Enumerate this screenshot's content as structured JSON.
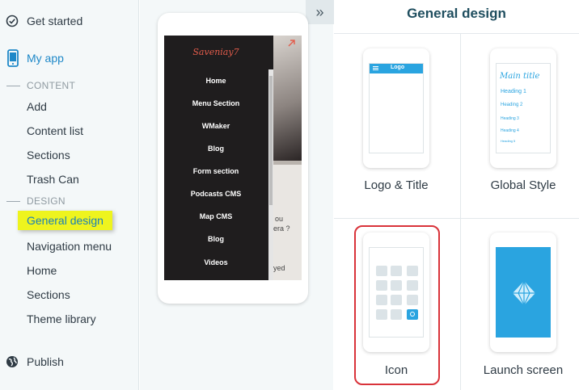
{
  "sidebar": {
    "get_started": "Get started",
    "my_app": "My app",
    "content_header": "CONTENT",
    "content_items": [
      "Add",
      "Content list",
      "Sections",
      "Trash Can"
    ],
    "design_header": "DESIGN",
    "design_items": [
      "General design",
      "Navigation menu",
      "Home",
      "Sections",
      "Theme library"
    ],
    "publish": "Publish"
  },
  "phone": {
    "brand_title": "Saveniay7",
    "menu_items": [
      "Home",
      "Menu Section",
      "WMaker",
      "Blog",
      "Form section",
      "Podcasts CMS",
      "Map CMS",
      "Blog",
      "Videos"
    ],
    "photo_text_1": "ou",
    "photo_text_2": "era ?",
    "photo_text_3": "yed"
  },
  "collapse_glyph": "»",
  "design_panel": {
    "title": "General design",
    "cards": [
      {
        "label": "Logo & Title",
        "preview_header": "Logo"
      },
      {
        "label": "Global Style",
        "preview_main": "Main title",
        "preview_headings": [
          "Heading 1",
          "Heading 2",
          "Heading 3",
          "Heading 4",
          "Heading 5"
        ]
      },
      {
        "label": "Icon"
      },
      {
        "label": "Launch screen"
      }
    ]
  },
  "colors": {
    "accent_blue": "#1e88c8",
    "highlight_yellow": "#eef41e",
    "selection_red": "#d9333a",
    "launch_blue": "#2aa4e0",
    "menu_bg": "#1f1d1e",
    "brand_red": "#e35c4b"
  },
  "icons": {
    "get_started": "check-circle-icon",
    "my_app": "smartphone-icon",
    "publish": "globe-icon",
    "collapse": "double-chevron-right-icon",
    "launch": "diamond-logo-icon"
  }
}
